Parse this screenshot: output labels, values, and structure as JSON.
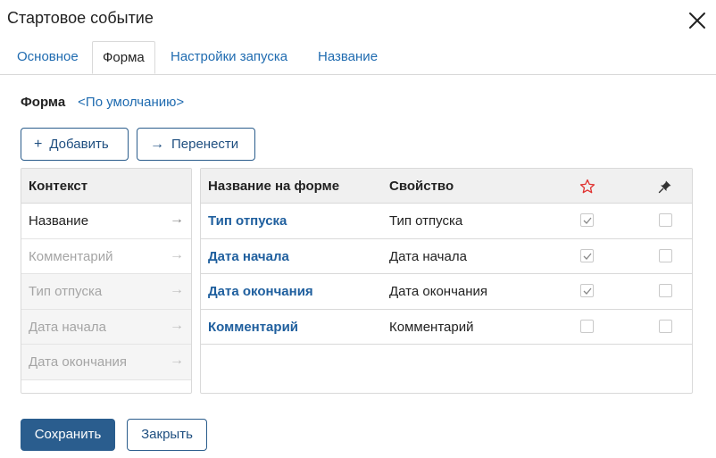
{
  "dialog": {
    "title": "Стартовое событие"
  },
  "tabs": [
    {
      "label": "Основное",
      "active": false
    },
    {
      "label": "Форма",
      "active": true
    },
    {
      "label": "Настройки запуска",
      "active": false
    },
    {
      "label": "Название",
      "active": false
    }
  ],
  "form": {
    "label": "Форма",
    "value_link": "<По умолчанию>"
  },
  "toolbar": {
    "add_label": "Добавить",
    "move_label": "Перенести",
    "add_icon": "plus-icon",
    "move_icon": "arrow-right-icon"
  },
  "context": {
    "header": "Контекст",
    "items": [
      {
        "label": "Название",
        "enabled": true
      },
      {
        "label": "Комментарий",
        "enabled": false
      },
      {
        "label": "Тип отпуска",
        "enabled": false
      },
      {
        "label": "Дата начала",
        "enabled": false
      },
      {
        "label": "Дата окончания",
        "enabled": false
      }
    ]
  },
  "fields_table": {
    "headers": {
      "name": "Название на форме",
      "property": "Свойство",
      "required_icon": "star-icon",
      "readonly_icon": "pin-icon"
    },
    "rows": [
      {
        "name": "Тип отпуска",
        "property": "Тип отпуска",
        "required": true,
        "readonly": false
      },
      {
        "name": "Дата начала",
        "property": "Дата начала",
        "required": true,
        "readonly": false
      },
      {
        "name": "Дата окончания",
        "property": "Дата окончания",
        "required": true,
        "readonly": false
      },
      {
        "name": "Комментарий",
        "property": "Комментарий",
        "required": false,
        "readonly": false
      }
    ]
  },
  "footer": {
    "save_label": "Сохранить",
    "close_label": "Закрыть"
  },
  "colors": {
    "accent": "#2a5d8e",
    "link": "#1f6bb0",
    "star": "#e0312f"
  }
}
